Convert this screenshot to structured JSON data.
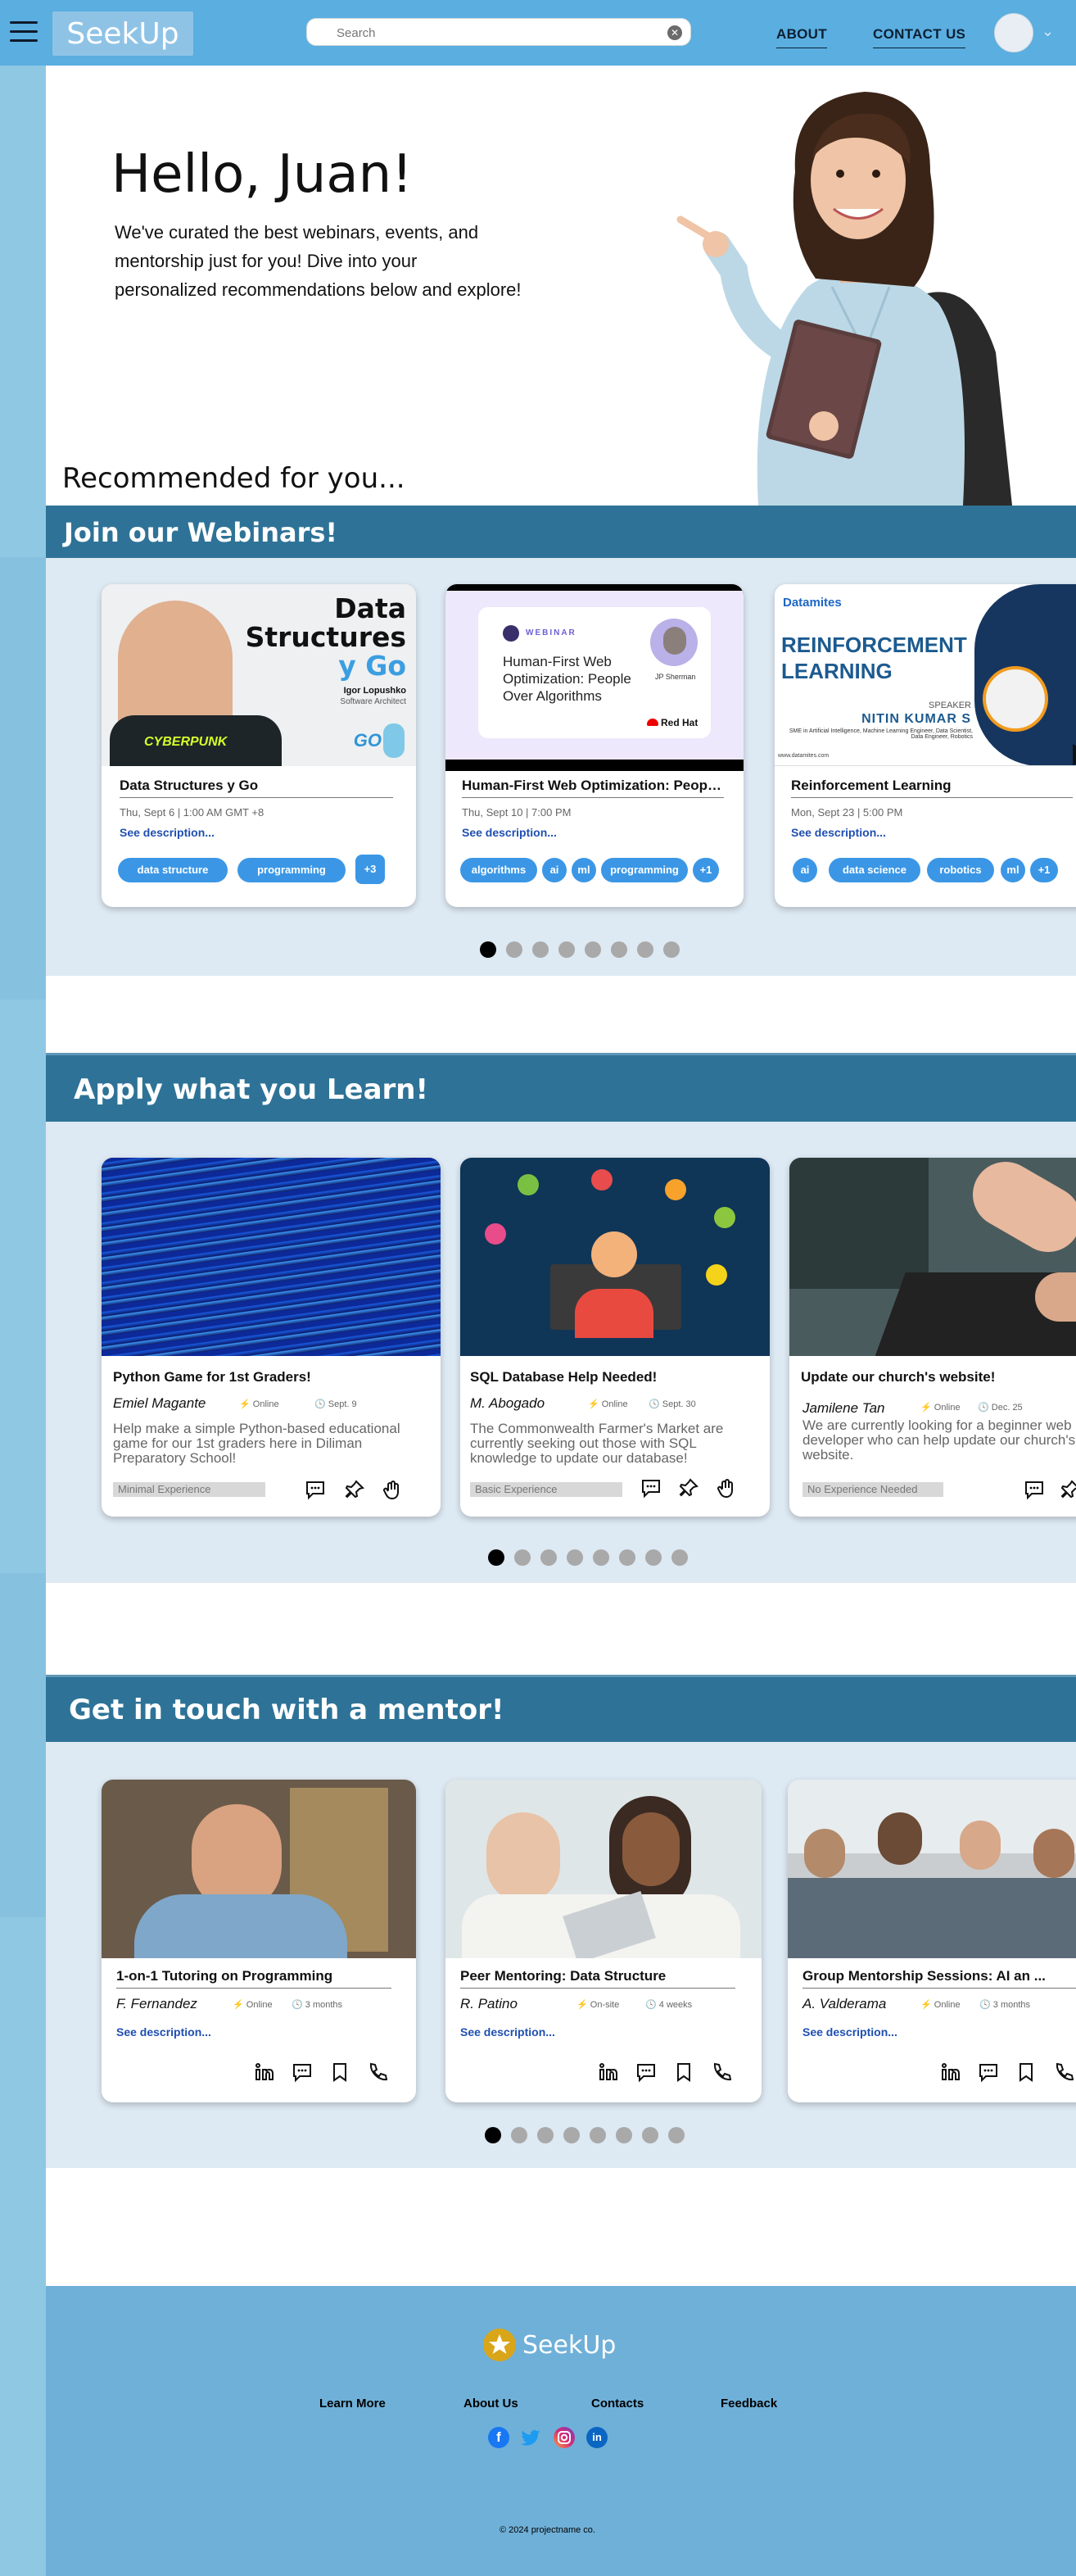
{
  "header": {
    "logo": "SeekUp",
    "search_placeholder": "Search",
    "nav": [
      "ABOUT",
      "CONTACT US"
    ]
  },
  "hero": {
    "greeting": "Hello, Juan!",
    "intro": "We've curated the best webinars, events, and mentorship just for you! Dive into your personalized recommendations below and explore!",
    "recommended": "Recommended for you..."
  },
  "webinars": {
    "title": "Join our Webinars!",
    "cards": [
      {
        "title": "Data Structures y Go",
        "date": "Thu, Sept 6 | 1:00 AM GMT +8",
        "desc": "See description...",
        "tags": [
          "data structure",
          "programming",
          "+3"
        ],
        "banner": {
          "line1": "Data",
          "line2": "Structures",
          "line3": "y Go",
          "speaker": "Igor Lopushko",
          "role": "Software Architect",
          "shirt": "CYBERPUNK",
          "go": "GO"
        }
      },
      {
        "title": "Human-First Web Optimization: People Over Algorithms",
        "date": "Thu, Sept 10 | 7:00 PM",
        "desc": "See description...",
        "tags": [
          "algorithms",
          "ai",
          "ml",
          "programming",
          "+1"
        ],
        "banner": {
          "kicker": "WEBINAR",
          "headline": "Human-First Web Optimization: People Over Algorithms",
          "speaker": "JP Sherman",
          "brand": "Red Hat"
        }
      },
      {
        "title": "Reinforcement Learning",
        "date": "Mon, Sept 23 | 5:00 PM",
        "desc": "See description...",
        "tags": [
          "ai",
          "data science",
          "robotics",
          "ml",
          "+1"
        ],
        "banner": {
          "brand": "Datamites",
          "headline1": "REINFORCEMENT",
          "headline2": "LEARNING",
          "speaker_label": "SPEAKER",
          "speaker": "NITIN KUMAR S",
          "role": "SME in Artificial Intelligence, Machine Learning Engineer, Data Scientist, Data Engineer, Robotics",
          "site": "www.datamites.com"
        }
      }
    ],
    "dots": 8
  },
  "projects": {
    "title": "Apply what you Learn!",
    "cards": [
      {
        "title": "Python Game for 1st Graders!",
        "name": "Emiel Magante",
        "mode": "Online",
        "when": "Sept. 9",
        "desc": "Help make a simple Python-based educational game for our 1st graders here in Diliman Preparatory School!",
        "level": "Minimal Experience"
      },
      {
        "title": "SQL Database Help Needed!",
        "name": "M. Abogado",
        "mode": "Online",
        "when": "Sept. 30",
        "desc": "The Commonwealth Farmer's Market are currently seeking out those with SQL knowledge to update our database!",
        "level": "Basic Experience"
      },
      {
        "title": "Update our church's website!",
        "name": "Jamilene Tan",
        "mode": "Online",
        "when": "Dec. 25",
        "desc": "We are currently looking for a beginner web developer who can help update our church's website.",
        "level": "No Experience Needed"
      }
    ],
    "dots": 8
  },
  "mentors": {
    "title": "Get in touch with a mentor!",
    "cards": [
      {
        "title": "1-on-1 Tutoring on Programming",
        "name": "F. Fernandez",
        "mode": "Online",
        "duration": "3 months",
        "desc": "See description..."
      },
      {
        "title": "Peer Mentoring: Data Structure",
        "name": "R. Patino",
        "mode": "On-site",
        "duration": "4 weeks",
        "desc": "See description..."
      },
      {
        "title": "Group Mentorship Sessions: AI an ...",
        "name": "A. Valderama",
        "mode": "Online",
        "duration": "3 months",
        "desc": "See description..."
      }
    ],
    "dots": 8
  },
  "footer": {
    "logo": "SeekUp",
    "links": [
      "Learn More",
      "About Us",
      "Contacts",
      "Feedback"
    ],
    "copyright": "© 2024 projectname co."
  },
  "colors": {
    "header": "#5aaee0",
    "section_bar": "#2e7397",
    "section_body": "#dde9f3",
    "tag": "#3b97e6",
    "footer": "#6fb0d8"
  }
}
